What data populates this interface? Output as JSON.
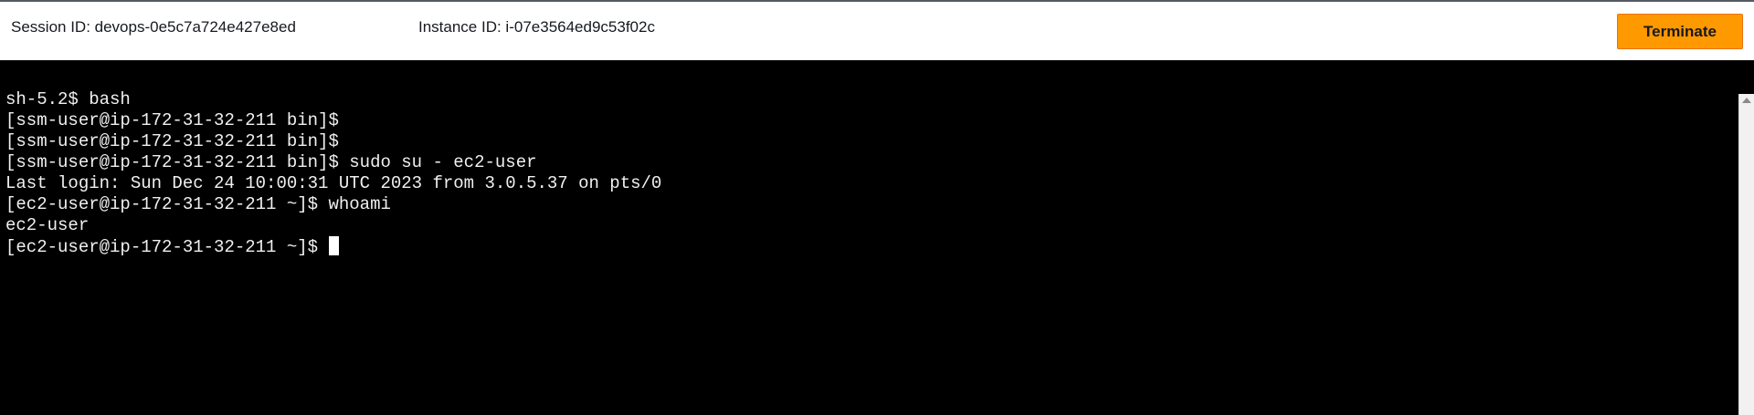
{
  "header": {
    "session_id_label": "Session ID: devops-0e5c7a724e427e8ed",
    "instance_id_label": "Instance ID: i-07e3564ed9c53f02c",
    "terminate_label": "Terminate"
  },
  "terminal": {
    "lines": [
      "sh-5.2$ bash",
      "[ssm-user@ip-172-31-32-211 bin]$",
      "[ssm-user@ip-172-31-32-211 bin]$",
      "[ssm-user@ip-172-31-32-211 bin]$ sudo su - ec2-user",
      "Last login: Sun Dec 24 10:00:31 UTC 2023 from 3.0.5.37 on pts/0",
      "[ec2-user@ip-172-31-32-211 ~]$ whoami",
      "ec2-user"
    ],
    "prompt": "[ec2-user@ip-172-31-32-211 ~]$ "
  },
  "colors": {
    "terminate_button": "#ff9900",
    "terminal_background": "#000000",
    "terminal_text": "#f0f0f0"
  }
}
